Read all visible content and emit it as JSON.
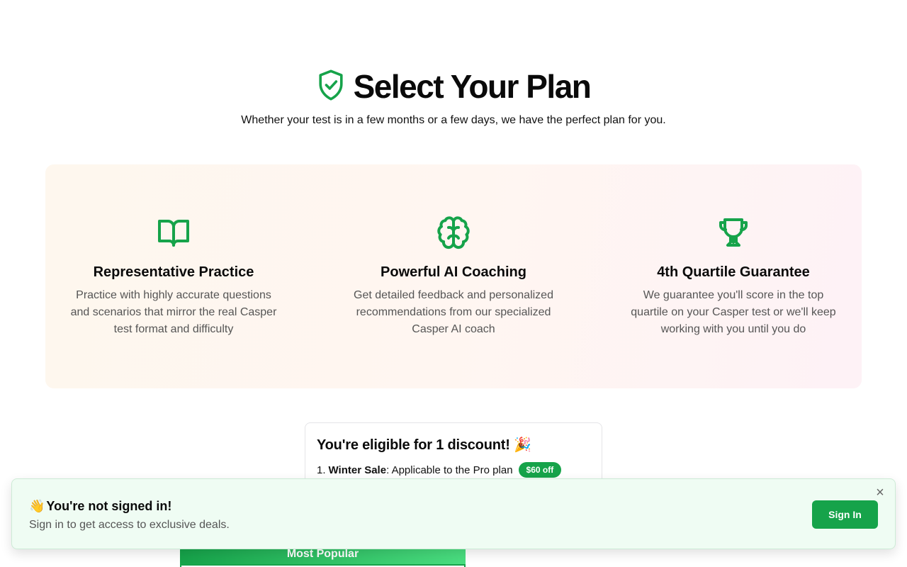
{
  "header": {
    "title": "Select Your Plan",
    "subtitle": "Whether your test is in a few months or a few days, we have the perfect plan for you.",
    "icon": "shield-check-icon"
  },
  "features": [
    {
      "icon": "book-open-icon",
      "title": "Representative Practice",
      "description": "Practice with highly accurate questions and scenarios that mirror the real Casper test format and difficulty"
    },
    {
      "icon": "brain-icon",
      "title": "Powerful AI Coaching",
      "description": "Get detailed feedback and personalized recommendations from our specialized Casper AI coach"
    },
    {
      "icon": "trophy-icon",
      "title": "4th Quartile Guarantee",
      "description": "We guarantee you'll score in the top quartile on your Casper test or we'll keep working with you until you do"
    }
  ],
  "discount": {
    "heading": "You're eligible for 1 discount!",
    "emoji": "🎉",
    "items": [
      {
        "index": "1.",
        "name": "Winter Sale",
        "text": ": Applicable to the Pro plan",
        "badge": "$60 off"
      }
    ]
  },
  "plan_card": {
    "ribbon": "Most Popular"
  },
  "toast": {
    "emoji": "👋",
    "title": "You're not signed in!",
    "body": "Sign in to get access to exclusive deals.",
    "button": "Sign In",
    "close": "×"
  },
  "colors": {
    "accent": "#16a34a",
    "toast_bg": "#effcf3"
  }
}
